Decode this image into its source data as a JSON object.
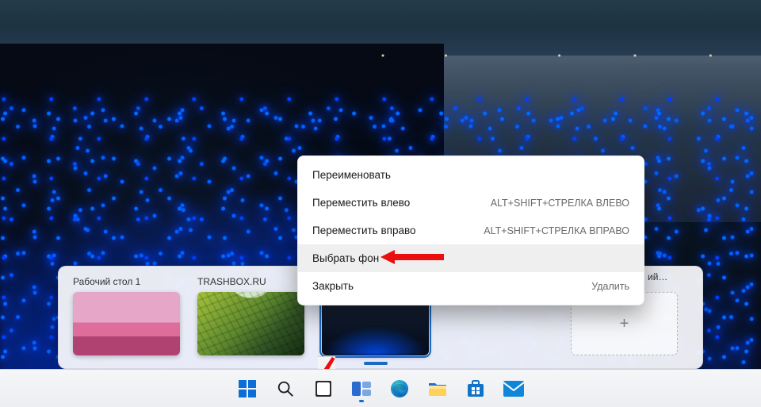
{
  "desk_panel": {
    "items": [
      {
        "label": "Рабочий стол 1",
        "thumb": "pink",
        "current": false
      },
      {
        "label": "TRASHBOX.RU",
        "thumb": "green",
        "current": false
      },
      {
        "label": "",
        "thumb": "night",
        "current": true
      },
      {
        "label": "ий…",
        "thumb": "",
        "current": false
      }
    ],
    "new_desktop_glyph": "+"
  },
  "context_menu": {
    "items": [
      {
        "label": "Переименовать",
        "accel": "",
        "hover": false
      },
      {
        "label": "Переместить влево",
        "accel": "ALT+SHIFT+СТРЕЛКА ВЛЕВО",
        "hover": false
      },
      {
        "label": "Переместить вправо",
        "accel": "ALT+SHIFT+СТРЕЛКА ВПРАВО",
        "hover": false
      },
      {
        "label": "Выбрать фон",
        "accel": "",
        "hover": true
      },
      {
        "label": "Закрыть",
        "accel": "Удалить",
        "hover": false
      }
    ]
  },
  "taskbar": {
    "icons": [
      {
        "name": "start-icon"
      },
      {
        "name": "search-icon"
      },
      {
        "name": "recents-icon"
      },
      {
        "name": "taskview-icon",
        "active": true
      },
      {
        "name": "edge-icon"
      },
      {
        "name": "explorer-icon"
      },
      {
        "name": "store-icon"
      },
      {
        "name": "mail-icon"
      }
    ]
  },
  "arrow_color": "#ea0e0e"
}
